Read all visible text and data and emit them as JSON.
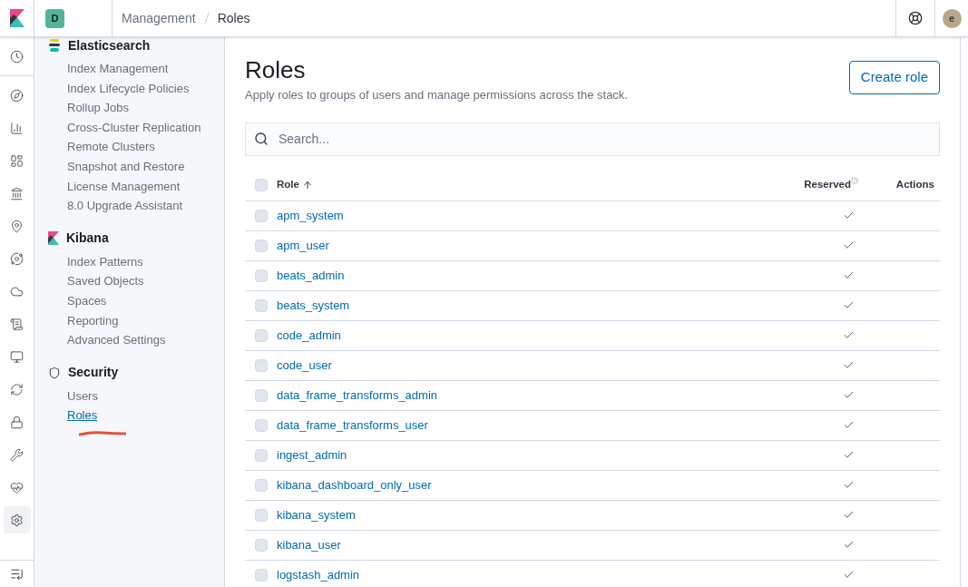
{
  "header": {
    "space_initial": "D",
    "breadcrumbs": [
      {
        "label": "Management",
        "selected": false
      },
      {
        "label": "Roles",
        "selected": true
      }
    ],
    "user_initial": "e"
  },
  "rail": {
    "items": [
      {
        "selected": false
      },
      {
        "selected": false
      },
      {
        "selected": false
      },
      {
        "selected": false
      },
      {
        "selected": false
      },
      {
        "selected": false
      },
      {
        "selected": false
      },
      {
        "selected": false
      },
      {
        "selected": false
      },
      {
        "selected": false
      },
      {
        "selected": false
      },
      {
        "selected": false
      },
      {
        "selected": false
      },
      {
        "selected": false
      },
      {
        "selected": true
      }
    ]
  },
  "sidebar": {
    "sections": [
      {
        "title": "Elasticsearch",
        "items": [
          {
            "label": "Index Management",
            "selected": false
          },
          {
            "label": "Index Lifecycle Policies",
            "selected": false
          },
          {
            "label": "Rollup Jobs",
            "selected": false
          },
          {
            "label": "Cross-Cluster Replication",
            "selected": false
          },
          {
            "label": "Remote Clusters",
            "selected": false
          },
          {
            "label": "Snapshot and Restore",
            "selected": false
          },
          {
            "label": "License Management",
            "selected": false
          },
          {
            "label": "8.0 Upgrade Assistant",
            "selected": false
          }
        ]
      },
      {
        "title": "Kibana",
        "items": [
          {
            "label": "Index Patterns",
            "selected": false
          },
          {
            "label": "Saved Objects",
            "selected": false
          },
          {
            "label": "Spaces",
            "selected": false
          },
          {
            "label": "Reporting",
            "selected": false
          },
          {
            "label": "Advanced Settings",
            "selected": false
          }
        ]
      },
      {
        "title": "Security",
        "items": [
          {
            "label": "Users",
            "selected": false
          },
          {
            "label": "Roles",
            "selected": true
          }
        ]
      }
    ]
  },
  "page": {
    "title": "Roles",
    "description": "Apply roles to groups of users and manage permissions across the stack.",
    "create_button": "Create role",
    "search": {
      "placeholder": "Search..."
    }
  },
  "table": {
    "columns": [
      "Role",
      "Reserved",
      "Actions"
    ],
    "all_checked": false,
    "rows": [
      {
        "name": "apm_system",
        "checked": false,
        "reserved": true
      },
      {
        "name": "apm_user",
        "checked": false,
        "reserved": true
      },
      {
        "name": "beats_admin",
        "checked": false,
        "reserved": true
      },
      {
        "name": "beats_system",
        "checked": false,
        "reserved": true
      },
      {
        "name": "code_admin",
        "checked": false,
        "reserved": true
      },
      {
        "name": "code_user",
        "checked": false,
        "reserved": true
      },
      {
        "name": "data_frame_transforms_admin",
        "checked": false,
        "reserved": true
      },
      {
        "name": "data_frame_transforms_user",
        "checked": false,
        "reserved": true
      },
      {
        "name": "ingest_admin",
        "checked": false,
        "reserved": true
      },
      {
        "name": "kibana_dashboard_only_user",
        "checked": false,
        "reserved": true
      },
      {
        "name": "kibana_system",
        "checked": false,
        "reserved": true
      },
      {
        "name": "kibana_user",
        "checked": false,
        "reserved": true
      },
      {
        "name": "logstash_admin",
        "checked": false,
        "reserved": true
      }
    ]
  }
}
